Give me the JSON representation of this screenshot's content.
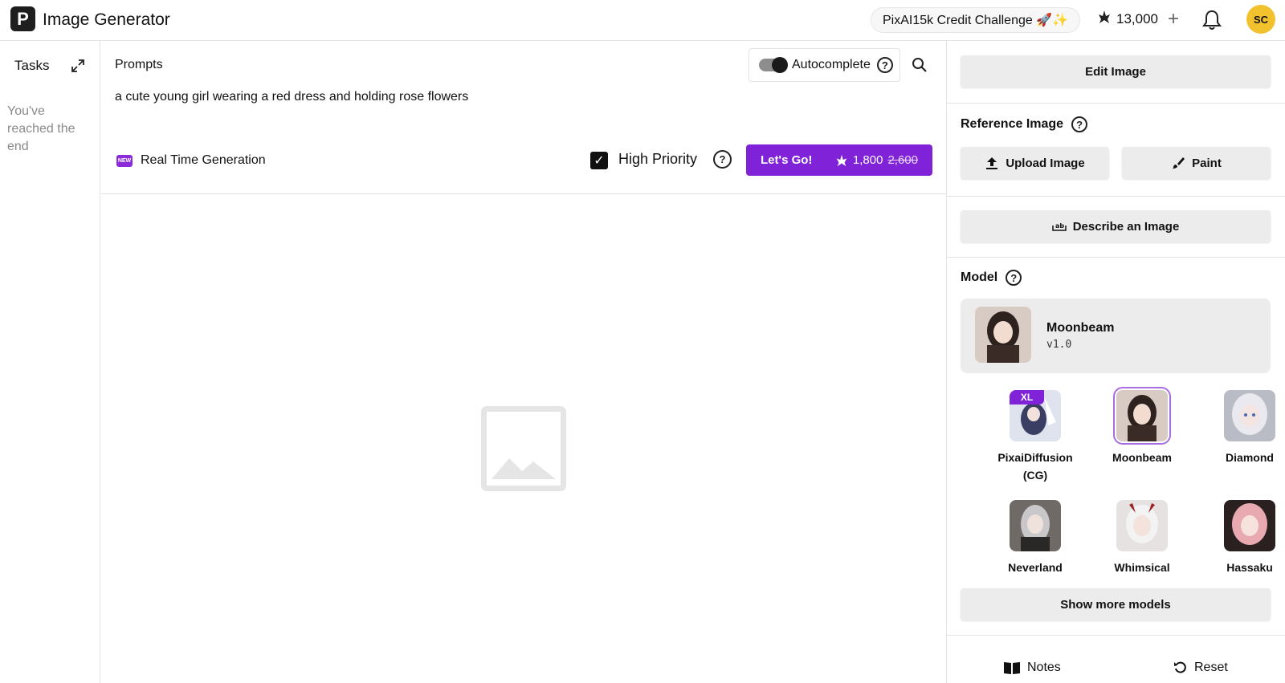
{
  "header": {
    "logo_letter": "P",
    "title": "Image Generator",
    "challenge": "PixAI15k Credit Challenge 🚀✨",
    "credits": "13,000",
    "avatar_initials": "SC"
  },
  "tasks": {
    "title": "Tasks",
    "end_message": "You've reached the end"
  },
  "prompt": {
    "label": "Prompts",
    "autocomplete_label": "Autocomplete",
    "text": "a cute young girl wearing a red dress and holding rose flowers",
    "new_badge": "NEW",
    "realtime_label": "Real Time Generation",
    "high_priority_label": "High Priority",
    "go_label": "Let's Go!",
    "cost": "1,800",
    "original_cost": "2,600"
  },
  "panel": {
    "edit_image": "Edit Image",
    "reference_title": "Reference Image",
    "upload_image": "Upload Image",
    "paint": "Paint",
    "describe": "Describe an Image",
    "model_title": "Model",
    "selected_model": {
      "name": "Moonbeam",
      "version": "v1.0"
    },
    "models": [
      {
        "name": "PixaiDiffusion(CG)",
        "badge": "XL"
      },
      {
        "name": "Moonbeam"
      },
      {
        "name": "Diamond"
      },
      {
        "name": "Neverland"
      },
      {
        "name": "Whimsical"
      },
      {
        "name": "Hassaku"
      }
    ],
    "show_more": "Show more models",
    "notes": "Notes",
    "reset": "Reset"
  },
  "colors": {
    "accent": "#7f22d8",
    "avatar": "#f2c12e"
  }
}
